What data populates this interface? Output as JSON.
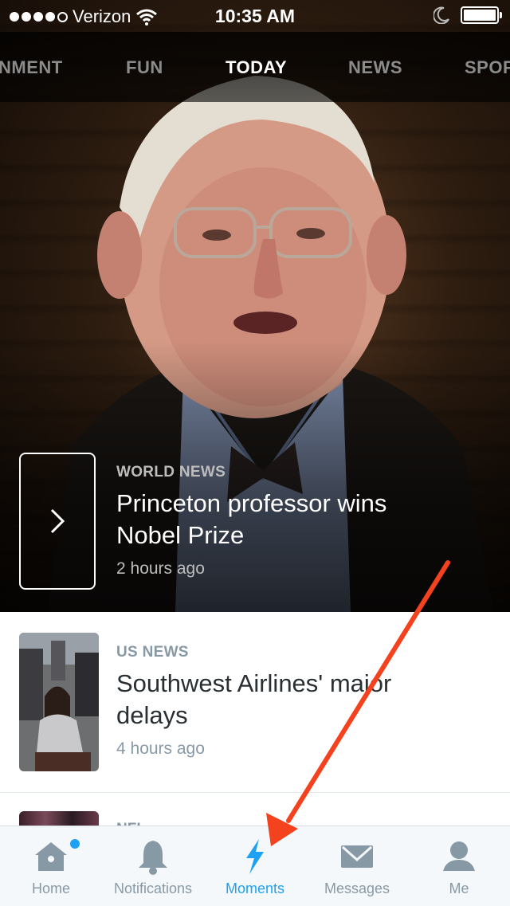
{
  "status_bar": {
    "carrier": "Verizon",
    "time": "10:35 AM"
  },
  "category_tabs": [
    {
      "label": "NMENT",
      "active": false
    },
    {
      "label": "FUN",
      "active": false
    },
    {
      "label": "TODAY",
      "active": true
    },
    {
      "label": "NEWS",
      "active": false
    },
    {
      "label": "SPOF",
      "active": false
    }
  ],
  "hero": {
    "category": "WORLD NEWS",
    "headline_line1": "Princeton professor wins",
    "headline_line2": "Nobel Prize",
    "time_ago": "2 hours ago"
  },
  "stories": [
    {
      "category": "US NEWS",
      "headline_line1": "Southwest Airlines' major",
      "headline_line2": "delays",
      "time_ago": "4 hours ago"
    },
    {
      "category": "NFL"
    }
  ],
  "tab_bar": {
    "items": [
      {
        "label": "Home",
        "icon": "home-icon"
      },
      {
        "label": "Notifications",
        "icon": "bell-icon"
      },
      {
        "label": "Moments",
        "icon": "lightning-icon"
      },
      {
        "label": "Messages",
        "icon": "envelope-icon"
      },
      {
        "label": "Me",
        "icon": "person-icon"
      }
    ],
    "active": "Moments"
  },
  "colors": {
    "accent": "#1da1f2",
    "inactive": "#8899a6",
    "arrow": "#f4411e"
  }
}
